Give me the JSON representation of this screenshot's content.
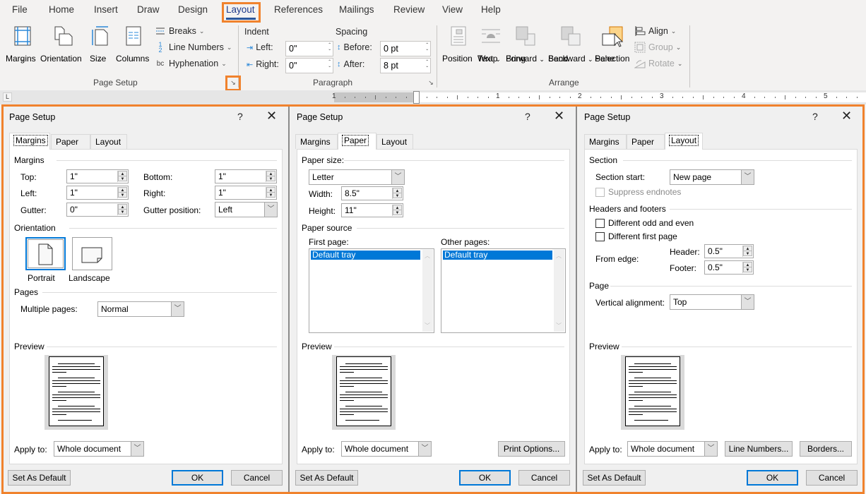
{
  "ribbon_tabs": [
    {
      "label": "File"
    },
    {
      "label": "Home"
    },
    {
      "label": "Insert"
    },
    {
      "label": "Draw"
    },
    {
      "label": "Design"
    },
    {
      "label": "Layout",
      "active": true
    },
    {
      "label": "References"
    },
    {
      "label": "Mailings"
    },
    {
      "label": "Review"
    },
    {
      "label": "View"
    },
    {
      "label": "Help"
    }
  ],
  "ribbon": {
    "page_setup": {
      "group_label": "Page Setup",
      "margins": "Margins",
      "orientation": "Orientation",
      "size": "Size",
      "columns": "Columns",
      "breaks": "Breaks",
      "line_numbers": "Line Numbers",
      "hyphenation": "Hyphenation"
    },
    "paragraph": {
      "group_label": "Paragraph",
      "indent_label": "Indent",
      "spacing_label": "Spacing",
      "left_label": "Left:",
      "left_value": "0\"",
      "right_label": "Right:",
      "right_value": "0\"",
      "before_label": "Before:",
      "before_value": "0 pt",
      "after_label": "After:",
      "after_value": "8 pt"
    },
    "arrange": {
      "group_label": "Arrange",
      "position": "Position",
      "wrap_text_1": "Wrap",
      "wrap_text_2": "Text",
      "bring_forward_1": "Bring",
      "bring_forward_2": "Forward",
      "send_backward_1": "Send",
      "send_backward_2": "Backward",
      "selection_pane_1": "Selection",
      "selection_pane_2": "Pane",
      "align": "Align",
      "group": "Group",
      "rotate": "Rotate"
    }
  },
  "ruler": {
    "corner": "L",
    "numbers": [
      "1",
      "1",
      "2",
      "3",
      "4",
      "5"
    ]
  },
  "dialogs": {
    "common": {
      "title": "Page Setup",
      "help": "?",
      "close": "✕",
      "tabs": [
        "Margins",
        "Paper",
        "Layout"
      ],
      "preview_label": "Preview",
      "apply_to_label": "Apply to:",
      "apply_to_value": "Whole document",
      "set_default": "Set As Default",
      "ok": "OK",
      "cancel": "Cancel"
    },
    "margins": {
      "section_margins": "Margins",
      "top_label": "Top:",
      "top_value": "1\"",
      "bottom_label": "Bottom:",
      "bottom_value": "1\"",
      "left_label": "Left:",
      "left_value": "1\"",
      "right_label": "Right:",
      "right_value": "1\"",
      "gutter_label": "Gutter:",
      "gutter_value": "0\"",
      "gutter_pos_label": "Gutter position:",
      "gutter_pos_value": "Left",
      "section_orientation": "Orientation",
      "portrait": "Portrait",
      "landscape": "Landscape",
      "section_pages": "Pages",
      "multiple_pages_label": "Multiple pages:",
      "multiple_pages_value": "Normal"
    },
    "paper": {
      "section_paper_size": "Paper size:",
      "paper_size_value": "Letter",
      "width_label": "Width:",
      "width_value": "8.5\"",
      "height_label": "Height:",
      "height_value": "11\"",
      "section_paper_source": "Paper source",
      "first_page_label": "First page:",
      "first_page_item": "Default tray",
      "other_pages_label": "Other pages:",
      "other_pages_item": "Default tray",
      "print_options": "Print Options..."
    },
    "layout": {
      "section_section": "Section",
      "section_start_label": "Section start:",
      "section_start_value": "New page",
      "suppress_endnotes": "Suppress endnotes",
      "section_headers": "Headers and footers",
      "diff_odd_even": "Different odd and even",
      "diff_first_page": "Different first page",
      "from_edge": "From edge:",
      "header_label": "Header:",
      "header_value": "0.5\"",
      "footer_label": "Footer:",
      "footer_value": "0.5\"",
      "section_page": "Page",
      "vertical_alignment_label": "Vertical alignment:",
      "vertical_alignment_value": "Top",
      "line_numbers": "Line Numbers...",
      "borders": "Borders..."
    }
  },
  "colors": {
    "highlight": "#f0822d",
    "accent": "#0078d7",
    "tab_underline": "#2b579a"
  }
}
